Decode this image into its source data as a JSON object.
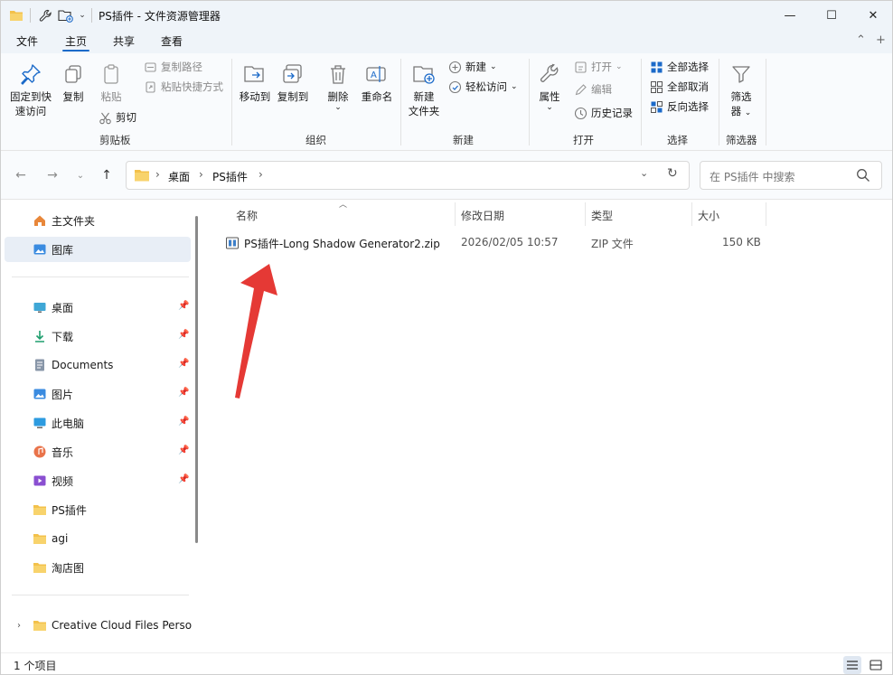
{
  "window": {
    "title": "PS插件 - 文件资源管理器",
    "controls": {
      "minimize": "—",
      "maximize": "☐",
      "close": "✕"
    }
  },
  "quick_access": {
    "icons": [
      "folder-icon",
      "wrench-icon",
      "new-folder-icon",
      "chevron-down-icon"
    ]
  },
  "tabs": [
    "文件",
    "主页",
    "共享",
    "查看"
  ],
  "active_tab": "主页",
  "ribbon": {
    "clipboard": {
      "pin_label_1": "固定到快",
      "pin_label_2": "速访问",
      "copy": "复制",
      "paste": "粘贴",
      "copy_path": "复制路径",
      "paste_shortcut": "粘贴快捷方式",
      "cut": "剪切",
      "group": "剪贴板"
    },
    "organize": {
      "move_to": "移动到",
      "copy_to": "复制到",
      "delete": "删除",
      "rename": "重命名",
      "group": "组织"
    },
    "new": {
      "new_folder_1": "新建",
      "new_folder_2": "文件夹",
      "new_item": "新建",
      "easy_access": "轻松访问",
      "group": "新建"
    },
    "open": {
      "properties": "属性",
      "open": "打开",
      "edit": "编辑",
      "history": "历史记录",
      "group": "打开"
    },
    "select": {
      "select_all": "全部选择",
      "select_none": "全部取消",
      "invert": "反向选择",
      "group": "选择"
    },
    "filter": {
      "filter_1": "筛选",
      "filter_2": "器",
      "group": "筛选器"
    }
  },
  "address": {
    "crumbs": [
      "桌面",
      "PS插件"
    ],
    "search_placeholder": "在 PS插件 中搜索"
  },
  "sidebar": {
    "top": [
      {
        "label": "主文件夹",
        "icon": "home-icon"
      },
      {
        "label": "图库",
        "icon": "gallery-icon",
        "selected": true
      }
    ],
    "pinned": [
      {
        "label": "桌面",
        "icon": "desktop-icon",
        "pinned": true
      },
      {
        "label": "下载",
        "icon": "download-icon",
        "pinned": true
      },
      {
        "label": "Documents",
        "icon": "documents-icon",
        "pinned": true
      },
      {
        "label": "图片",
        "icon": "pictures-icon",
        "pinned": true
      },
      {
        "label": "此电脑",
        "icon": "this-pc-icon",
        "pinned": true
      },
      {
        "label": "音乐",
        "icon": "music-icon",
        "pinned": true
      },
      {
        "label": "视频",
        "icon": "video-icon",
        "pinned": true
      },
      {
        "label": "PS插件",
        "icon": "folder-icon",
        "pinned": false
      },
      {
        "label": "agi",
        "icon": "folder-icon",
        "pinned": false
      },
      {
        "label": "淘店图",
        "icon": "folder-icon",
        "pinned": false
      }
    ],
    "cloud": {
      "label": "Creative Cloud Files Personal",
      "icon": "folder-icon"
    }
  },
  "columns": {
    "name": "名称",
    "modified": "修改日期",
    "type": "类型",
    "size": "大小"
  },
  "files": [
    {
      "name": "PS插件-Long Shadow Generator2.zip",
      "modified": "2026/02/05 10:57",
      "type": "ZIP 文件",
      "size": "150 KB"
    }
  ],
  "status": {
    "count": "1 个项目"
  },
  "colors": {
    "accent": "#1b6ac9",
    "arrow": "#e53935",
    "folder": "#f3c14b"
  }
}
